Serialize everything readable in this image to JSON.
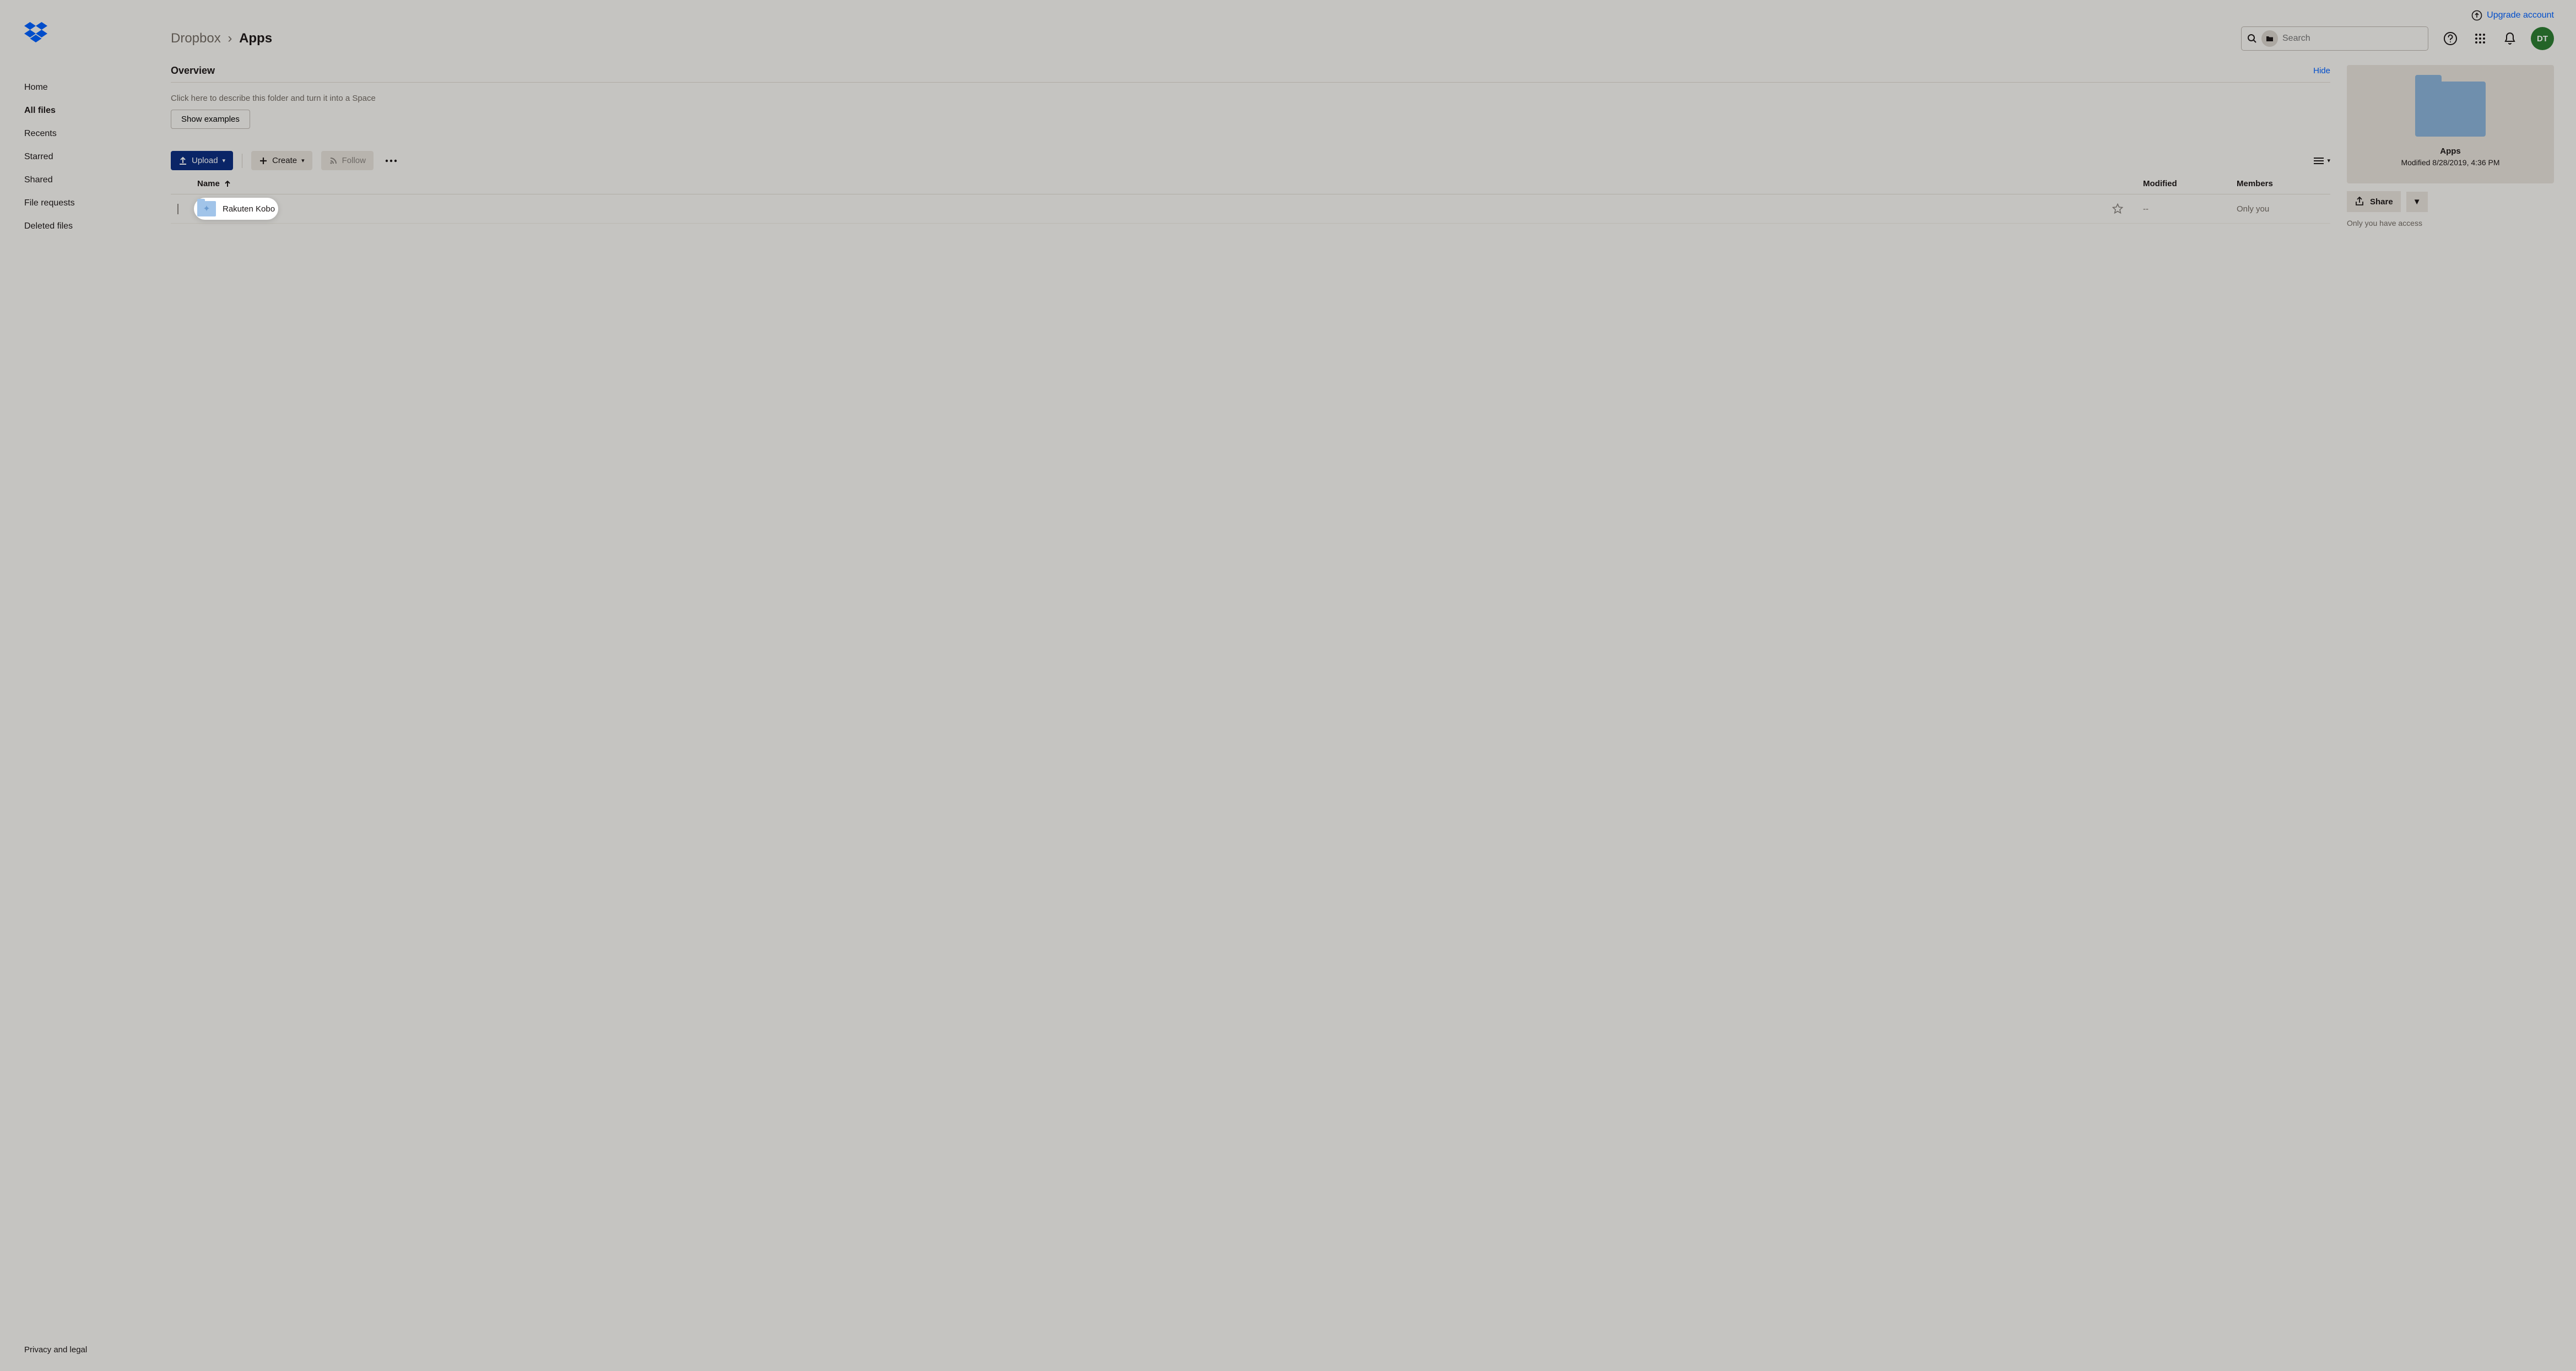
{
  "topbar": {
    "upgrade_label": "Upgrade account",
    "avatar_initials": "DT"
  },
  "sidebar": {
    "items": [
      {
        "label": "Home"
      },
      {
        "label": "All files"
      },
      {
        "label": "Recents"
      },
      {
        "label": "Starred"
      },
      {
        "label": "Shared"
      },
      {
        "label": "File requests"
      },
      {
        "label": "Deleted files"
      }
    ],
    "footer_label": "Privacy and legal"
  },
  "breadcrumb": {
    "root": "Dropbox",
    "separator": "›",
    "current": "Apps"
  },
  "search": {
    "placeholder": "Search"
  },
  "overview": {
    "title": "Overview",
    "hide_label": "Hide",
    "description_placeholder": "Click here to describe this folder and turn it into a Space",
    "show_examples_label": "Show examples"
  },
  "toolbar": {
    "upload_label": "Upload",
    "create_label": "Create",
    "follow_label": "Follow",
    "more_label": "…"
  },
  "table": {
    "columns": {
      "name": "Name",
      "modified": "Modified",
      "members": "Members"
    },
    "rows": [
      {
        "name": "Rakuten Kobo",
        "modified": "--",
        "members": "Only you"
      }
    ]
  },
  "side_panel": {
    "folder_name": "Apps",
    "modified_label": "Modified 8/28/2019, 4:36 PM",
    "share_label": "Share",
    "access_label": "Only you have access"
  }
}
